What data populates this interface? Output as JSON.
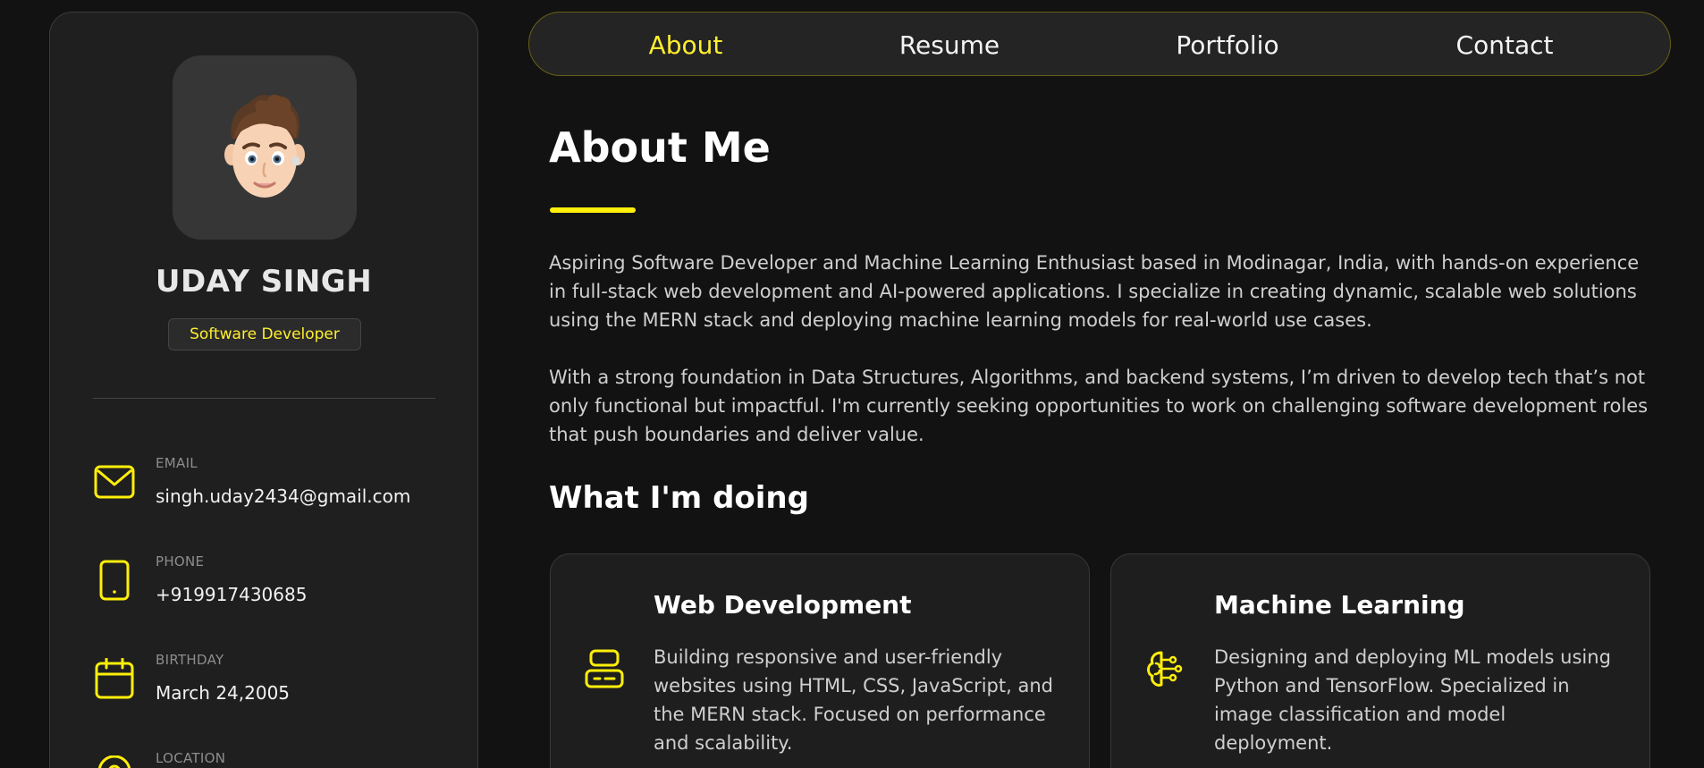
{
  "colors": {
    "accent": "#ffef2f",
    "background": "#121212",
    "panel": "#1f1f1f"
  },
  "sidebar": {
    "avatar": {
      "icon": "memoji-avatar"
    },
    "name": "UDAY SINGH",
    "title": "Software Developer",
    "contacts": [
      {
        "icon": "mail-icon",
        "label": "EMAIL",
        "value": "singh.uday2434@gmail.com"
      },
      {
        "icon": "phone-icon",
        "label": "PHONE",
        "value": "+919917430685"
      },
      {
        "icon": "calendar-icon",
        "label": "BIRTHDAY",
        "value": "March 24,2005"
      },
      {
        "icon": "location-icon",
        "label": "LOCATION",
        "value": ""
      }
    ]
  },
  "nav": {
    "items": [
      {
        "label": "About",
        "active": true
      },
      {
        "label": "Resume",
        "active": false
      },
      {
        "label": "Portfolio",
        "active": false
      },
      {
        "label": "Contact",
        "active": false
      }
    ]
  },
  "about": {
    "heading": "About Me",
    "paragraphs": [
      "Aspiring Software Developer and Machine Learning Enthusiast based in Modinagar, India, with hands-on experience in full-stack web development and AI-powered applications. I specialize in creating dynamic, scalable web solutions using the MERN stack and deploying machine learning models for real-world use cases.",
      "With a strong foundation in Data Structures, Algorithms, and backend systems, I’m driven to develop tech that’s not only functional but impactful. I'm currently seeking opportunities to work on challenging software development roles that push boundaries and deliver value."
    ]
  },
  "services": {
    "heading": "What I'm doing",
    "items": [
      {
        "icon": "server-icon",
        "title": "Web Development",
        "text": "Building responsive and user-friendly websites using HTML, CSS, JavaScript, and the MERN stack. Focused on performance and scalability."
      },
      {
        "icon": "brain-icon",
        "title": "Machine Learning",
        "text": "Designing and deploying ML models using Python and TensorFlow. Specialized in image classification and model deployment."
      }
    ]
  }
}
